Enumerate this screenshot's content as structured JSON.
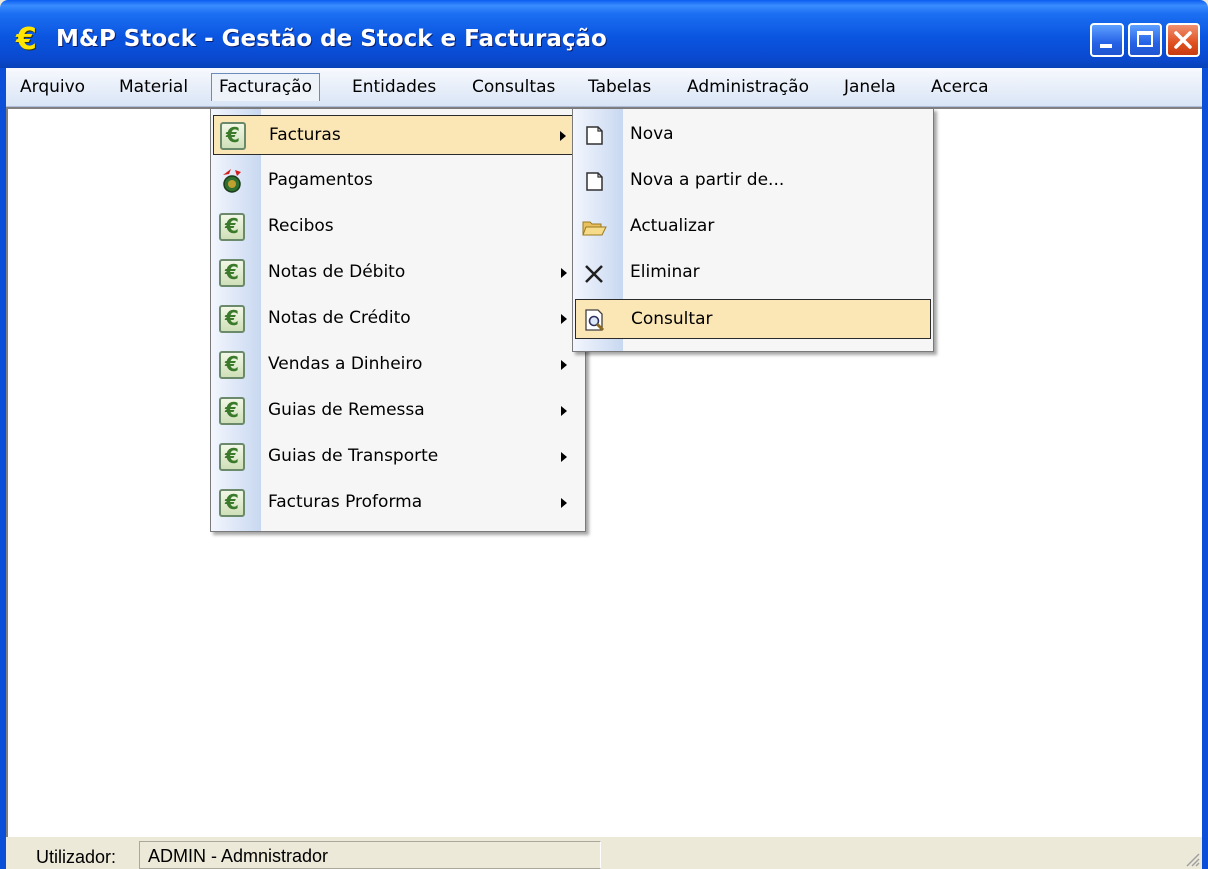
{
  "title": {
    "text": "M&P Stock - Gestão de Stock e Facturação",
    "icon": "euro-icon"
  },
  "titlebar_buttons": {
    "minimize": "minimize-icon",
    "maximize": "maximize-icon",
    "close": "close-icon"
  },
  "menubar": [
    {
      "label": "Arquivo"
    },
    {
      "label": "Material"
    },
    {
      "label": "Facturação",
      "open": true
    },
    {
      "label": "Entidades"
    },
    {
      "label": "Consultas"
    },
    {
      "label": "Tabelas"
    },
    {
      "label": "Administração"
    },
    {
      "label": "Janela"
    },
    {
      "label": "Acerca"
    }
  ],
  "facturacao_menu": [
    {
      "label": "Facturas",
      "icon": "euro-icon",
      "submenu": true,
      "highlighted": true
    },
    {
      "label": "Pagamentos",
      "icon": "payment-icon",
      "submenu": false
    },
    {
      "label": "Recibos",
      "icon": "euro-icon",
      "submenu": false
    },
    {
      "label": "Notas de Débito",
      "icon": "euro-icon",
      "submenu": true
    },
    {
      "label": "Notas de Crédito",
      "icon": "euro-icon",
      "submenu": true
    },
    {
      "label": "Vendas a Dinheiro",
      "icon": "euro-icon",
      "submenu": true
    },
    {
      "label": "Guias de Remessa",
      "icon": "euro-icon",
      "submenu": true
    },
    {
      "label": "Guias de Transporte",
      "icon": "euro-icon",
      "submenu": true
    },
    {
      "label": "Facturas Proforma",
      "icon": "euro-icon",
      "submenu": true
    }
  ],
  "facturas_submenu": [
    {
      "label": "Nova",
      "icon": "new-document-icon"
    },
    {
      "label": "Nova a partir de...",
      "icon": "new-document-icon"
    },
    {
      "label": "Actualizar",
      "icon": "open-folder-icon"
    },
    {
      "label": "Eliminar",
      "icon": "delete-x-icon"
    },
    {
      "label": "Consultar",
      "icon": "print-preview-icon",
      "highlighted": true
    }
  ],
  "statusbar": {
    "label": "Utilizador:",
    "value": "ADMIN - Admnistrador"
  },
  "colors": {
    "titlebar": "#0a55e0",
    "menu_highlight": "#fbe6b6",
    "close_button": "#e05020",
    "title_icon": "#ffe500"
  }
}
